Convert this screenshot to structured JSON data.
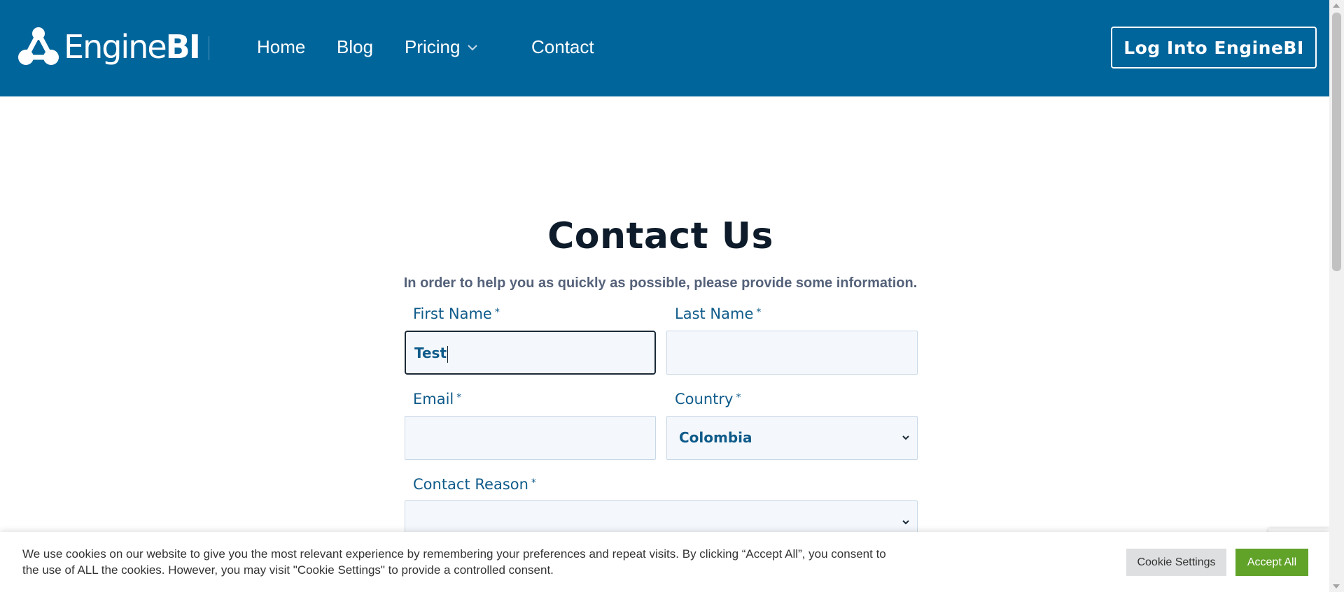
{
  "header": {
    "logo_text_light": "Engine",
    "logo_text_bold": "BI",
    "nav": [
      {
        "label": "Home"
      },
      {
        "label": "Blog"
      },
      {
        "label": "Pricing"
      },
      {
        "label": "Contact"
      }
    ],
    "login_label": "Log Into EngineBI",
    "brand_color": "#00659b"
  },
  "main": {
    "title": "Contact Us",
    "subtitle": "In order to help you as quickly as possible, please provide some information.",
    "required_mark": "*",
    "fields": {
      "first_name": {
        "label": "First Name",
        "value": "Test"
      },
      "last_name": {
        "label": "Last Name",
        "value": ""
      },
      "email": {
        "label": "Email",
        "value": ""
      },
      "country": {
        "label": "Country",
        "value": "Colombia"
      },
      "contact_reason": {
        "label": "Contact Reason",
        "value": ""
      }
    }
  },
  "cookie_banner": {
    "text": "We use cookies on our website to give you the most relevant experience by remembering your preferences and repeat visits. By clicking “Accept All”, you consent to the use of ALL the cookies. However, you may visit \"Cookie Settings\" to provide a controlled consent.",
    "settings_label": "Cookie Settings",
    "accept_label": "Accept All",
    "accept_color": "#61a229"
  }
}
